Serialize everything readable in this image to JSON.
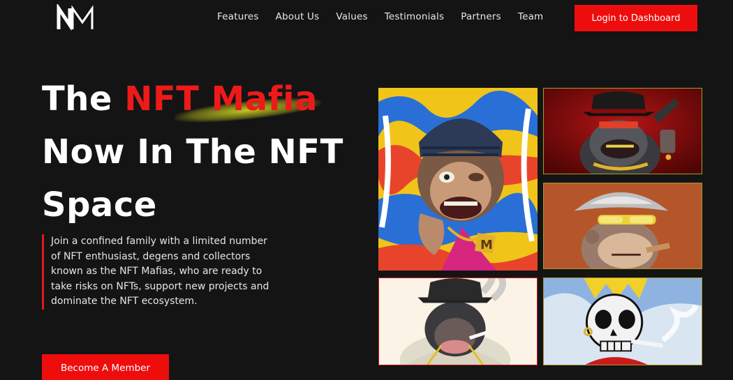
{
  "brand": {
    "logo_text": "NM"
  },
  "nav": {
    "links": [
      "Features",
      "About Us",
      "Values",
      "Testimonials",
      "Partners",
      "Team"
    ],
    "login_label": "Login to Dashboard"
  },
  "hero": {
    "title_prefix": "The ",
    "title_accent": "NFT Mafia",
    "title_line2": "Now In The NFT",
    "title_line3": "Space",
    "description": "Join a confined family with a limited number of NFT enthusiast, degens and collectors known as the NFT Mafias, who are ready to take risks on NFTs, support new projects and dominate the NFT ecosystem.",
    "cta_label": "Become A Member"
  },
  "gallery": {
    "tiles": [
      {
        "icon": "beanie-chimp-nft"
      },
      {
        "icon": "fedora-gorilla-gun-nft"
      },
      {
        "icon": "bucket-hat-ape-nft"
      },
      {
        "icon": "smoking-gorilla-nft"
      },
      {
        "icon": "crowned-skull-nft"
      }
    ]
  },
  "colors": {
    "accent": "#ee0d0d",
    "background": "#141414",
    "highlight": "#e1e61e"
  }
}
